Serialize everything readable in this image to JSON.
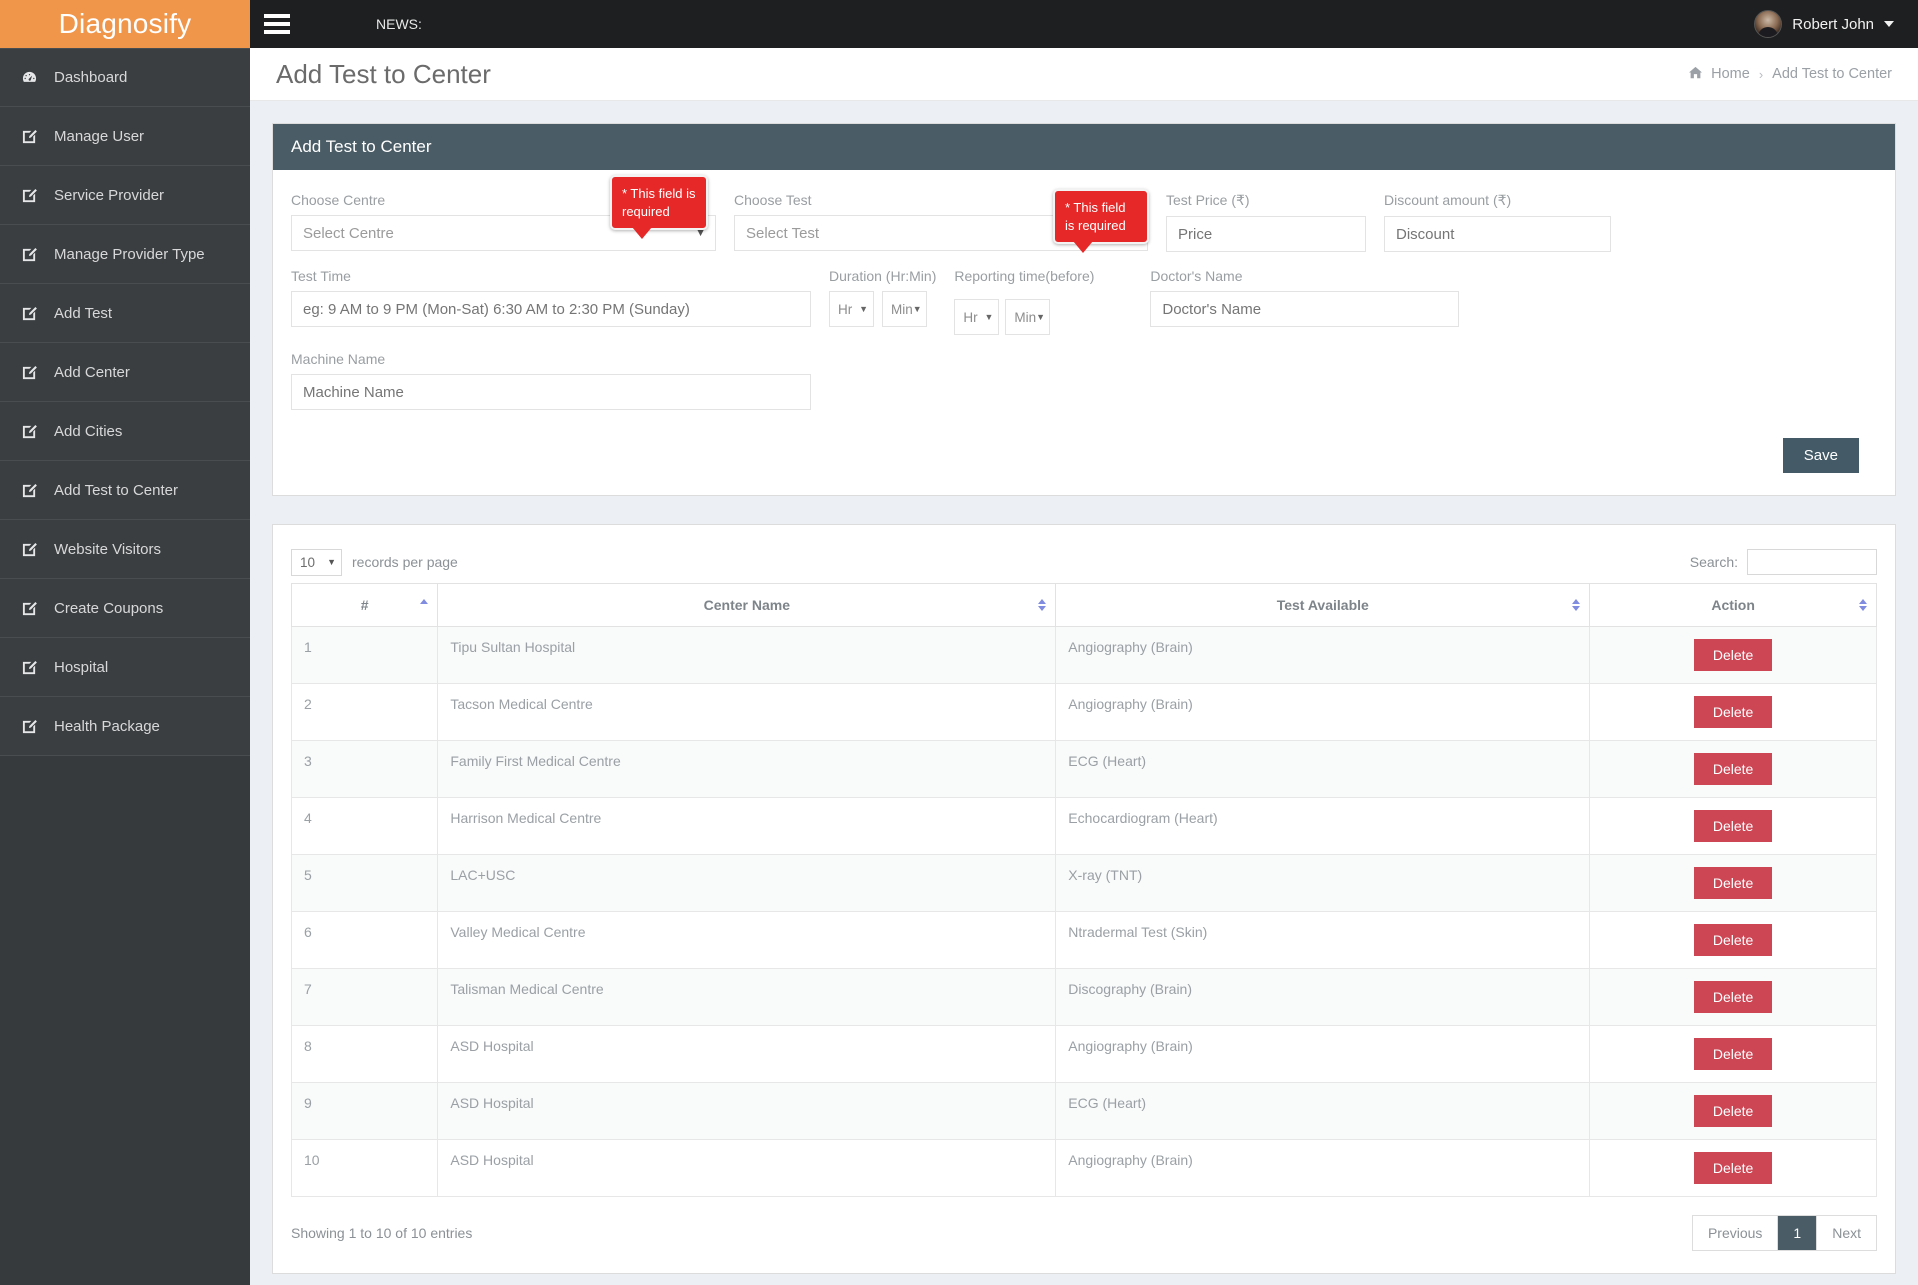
{
  "brand": {
    "name": "Diagnosify"
  },
  "topbar": {
    "menu_icon": "hamburger-icon",
    "news_label": "NEWS:",
    "user_name": "Robert John"
  },
  "sidebar": {
    "items": [
      {
        "label": "Dashboard",
        "icon": "dashboard-icon"
      },
      {
        "label": "Manage User",
        "icon": "edit-icon"
      },
      {
        "label": "Service Provider",
        "icon": "edit-icon"
      },
      {
        "label": "Manage Provider Type",
        "icon": "edit-icon"
      },
      {
        "label": "Add Test",
        "icon": "edit-icon"
      },
      {
        "label": "Add Center",
        "icon": "edit-icon"
      },
      {
        "label": "Add Cities",
        "icon": "edit-icon"
      },
      {
        "label": "Add Test to Center",
        "icon": "edit-icon"
      },
      {
        "label": "Website Visitors",
        "icon": "edit-icon"
      },
      {
        "label": "Create Coupons",
        "icon": "edit-icon"
      },
      {
        "label": "Hospital",
        "icon": "edit-icon"
      },
      {
        "label": "Health Package",
        "icon": "edit-icon"
      }
    ]
  },
  "page": {
    "title": "Add Test to Center",
    "breadcrumb": {
      "home": "Home",
      "separator": "›",
      "current": "Add Test to Center",
      "home_icon": "home-icon"
    }
  },
  "form_panel": {
    "heading": "Add Test to Center",
    "fields": {
      "choose_centre": {
        "label": "Choose Centre",
        "value": "Select Centre"
      },
      "choose_test": {
        "label": "Choose Test",
        "value": "Select Test"
      },
      "test_price": {
        "label": "Test Price (₹)",
        "placeholder": "Price"
      },
      "discount_amount": {
        "label": "Discount amount (₹)",
        "placeholder": "Discount"
      },
      "test_time": {
        "label": "Test Time",
        "placeholder": "eg: 9 AM to 9 PM (Mon-Sat) 6:30 AM to 2:30 PM (Sunday)"
      },
      "duration": {
        "label": "Duration (Hr:Min)",
        "hr": "Hr",
        "min": "Min"
      },
      "reporting_time": {
        "label": "Reporting time(before)",
        "hr": "Hr",
        "min": "Min"
      },
      "doctors_name": {
        "label": "Doctor's Name",
        "placeholder": "Doctor's Name"
      },
      "machine_name": {
        "label": "Machine Name",
        "placeholder": "Machine Name"
      }
    },
    "errors": [
      {
        "text": "* This field is required"
      },
      {
        "text": "* This field is required"
      }
    ],
    "save_label": "Save"
  },
  "table_panel": {
    "length_value": "10",
    "length_text": "records per page",
    "search_label": "Search:",
    "search_value": "",
    "columns": [
      "#",
      "Center Name",
      "Test Available",
      "Action"
    ],
    "rows": [
      {
        "num": "1",
        "center": "Tipu Sultan Hospital",
        "test": "Angiography (Brain)",
        "action": "Delete"
      },
      {
        "num": "2",
        "center": "Tacson Medical Centre",
        "test": "Angiography (Brain)",
        "action": "Delete"
      },
      {
        "num": "3",
        "center": "Family First Medical Centre",
        "test": "ECG (Heart)",
        "action": "Delete"
      },
      {
        "num": "4",
        "center": "Harrison Medical Centre",
        "test": "Echocardiogram (Heart)",
        "action": "Delete"
      },
      {
        "num": "5",
        "center": "LAC+USC",
        "test": "X-ray (TNT)",
        "action": "Delete"
      },
      {
        "num": "6",
        "center": "Valley Medical Centre",
        "test": "Ntradermal Test (Skin)",
        "action": "Delete"
      },
      {
        "num": "7",
        "center": "Talisman Medical Centre",
        "test": "Discography (Brain)",
        "action": "Delete"
      },
      {
        "num": "8",
        "center": "ASD Hospital",
        "test": "Angiography (Brain)",
        "action": "Delete"
      },
      {
        "num": "9",
        "center": "ASD Hospital",
        "test": "ECG (Heart)",
        "action": "Delete"
      },
      {
        "num": "10",
        "center": "ASD Hospital",
        "test": "Angiography (Brain)",
        "action": "Delete"
      }
    ],
    "info": "Showing 1 to 10 of 10 entries",
    "pagination": {
      "previous": "Previous",
      "current": "1",
      "next": "Next"
    }
  },
  "colors": {
    "brand_orange": "#f0964b",
    "sidebar_dark": "#3b3e40",
    "topbar_dark": "#1d1f20",
    "panel_heading": "#4a5c66",
    "danger_red": "#cc4654",
    "error_red": "#e62828"
  }
}
